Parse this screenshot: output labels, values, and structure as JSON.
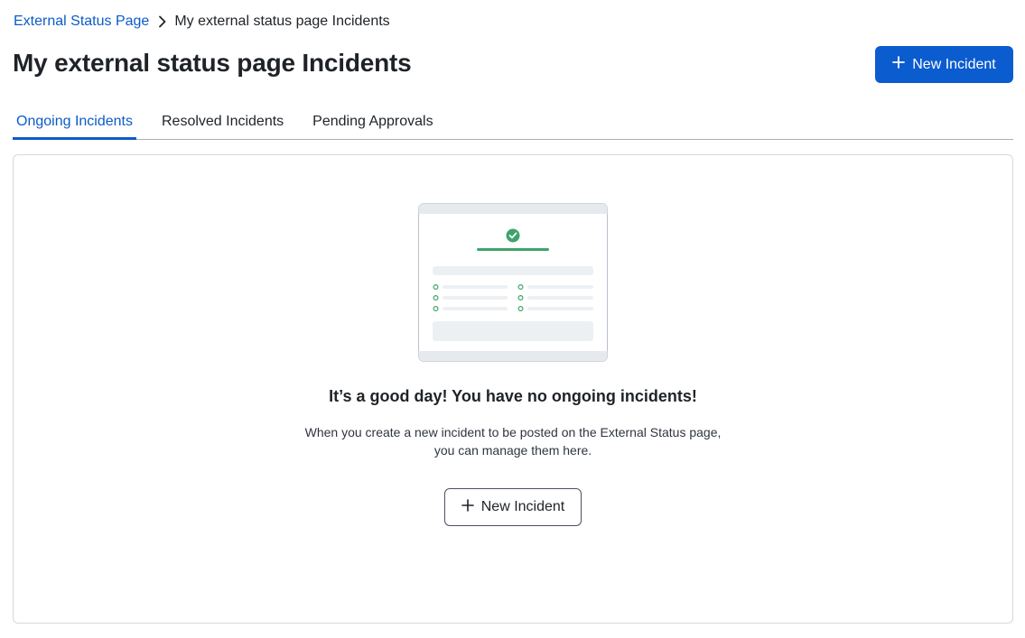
{
  "breadcrumb": {
    "parent": "External Status Page",
    "current": "My external status page Incidents"
  },
  "header": {
    "title": "My external status page Incidents",
    "new_incident_label": "New Incident"
  },
  "tabs": [
    {
      "label": "Ongoing Incidents",
      "active": true
    },
    {
      "label": "Resolved Incidents",
      "active": false
    },
    {
      "label": "Pending Approvals",
      "active": false
    }
  ],
  "empty_state": {
    "title": "It’s a good day! You have no ongoing incidents!",
    "description_line1": "When you create a new incident to be posted on the External Status page,",
    "description_line2": "you can manage them here.",
    "button_label": "New Incident"
  },
  "colors": {
    "primary": "#0b5ccf",
    "success": "#3ea46b",
    "border": "#d4d8de"
  }
}
